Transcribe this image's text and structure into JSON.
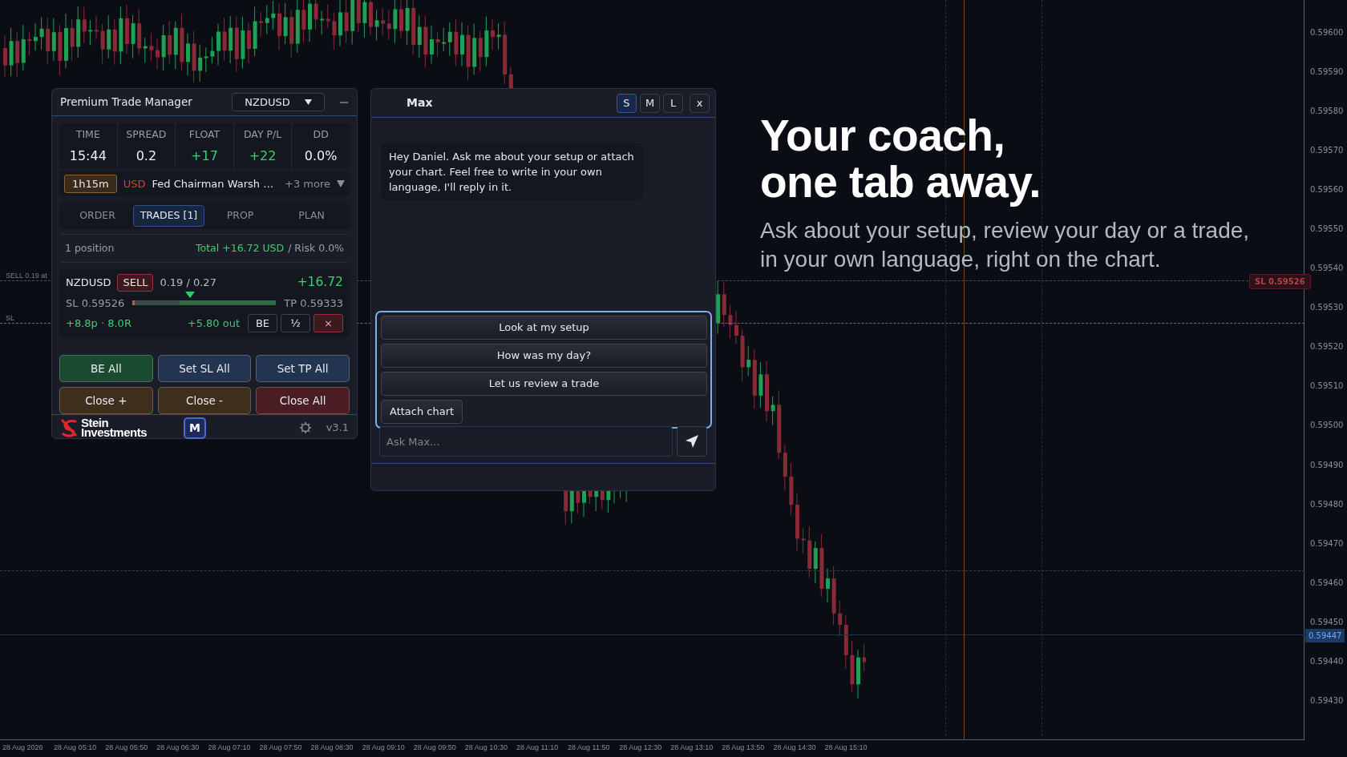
{
  "chart": {
    "price_labels": [
      "0.59600",
      "0.59590",
      "0.59580",
      "0.59570",
      "0.59560",
      "0.59550",
      "0.59540",
      "0.59530",
      "0.59520",
      "0.59510",
      "0.59500",
      "0.59490",
      "0.59480",
      "0.59470",
      "0.59460",
      "0.59450",
      "0.59440",
      "0.59430"
    ],
    "time_labels": [
      "28 Aug 2026",
      "28 Aug 05:10",
      "28 Aug 05:50",
      "28 Aug 06:30",
      "28 Aug 07:10",
      "28 Aug 07:50",
      "28 Aug 08:30",
      "28 Aug 09:10",
      "28 Aug 09:50",
      "28 Aug 10:30",
      "28 Aug 11:10",
      "28 Aug 11:50",
      "28 Aug 12:30",
      "28 Aug 13:10",
      "28 Aug 13:50",
      "28 Aug 14:30",
      "28 Aug 15:10"
    ],
    "current_price": "0.59447",
    "sl_tag": "SL 0.59526",
    "trade_line_label": "SELL 0.19 at",
    "sl_line_label": "SL"
  },
  "trade_manager": {
    "title": "Premium Trade Manager",
    "symbol": "NZDUSD",
    "stats": [
      {
        "label": "TIME",
        "value": "15:44",
        "kind": "plain"
      },
      {
        "label": "SPREAD",
        "value": "0.2",
        "kind": "plain"
      },
      {
        "label": "FLOAT",
        "value": "+17",
        "kind": "gain"
      },
      {
        "label": "DAY P/L",
        "value": "+22",
        "kind": "gain"
      },
      {
        "label": "DD",
        "value": "0.0%",
        "kind": "plain"
      }
    ],
    "news": {
      "countdown": "1h15m",
      "currency": "USD",
      "headline": "Fed Chairman Warsh …",
      "more": "+3 more"
    },
    "tabs": [
      {
        "label": "ORDER",
        "selected": false
      },
      {
        "label": "TRADES [1]",
        "selected": true
      },
      {
        "label": "PROP",
        "selected": false
      },
      {
        "label": "PLAN",
        "selected": false
      }
    ],
    "summary": {
      "count": "1 position",
      "total": "Total +16.72 USD",
      "risk": "/ Risk 0.0%"
    },
    "position": {
      "symbol": "NZDUSD",
      "side": "SELL",
      "lots": "0.19 / 0.27",
      "pnl": "+16.72",
      "sl": "SL 0.59526",
      "tp": "TP 0.59333",
      "level": 0.4,
      "pips": "+8.8p · 8.0R",
      "out": "+5.80 out",
      "buttons": [
        {
          "label": "BE",
          "kind": "plain"
        },
        {
          "label": "½",
          "kind": "plain"
        },
        {
          "label": "×",
          "kind": "danger"
        }
      ]
    },
    "actions": [
      {
        "label": "BE All",
        "color": "#1a4a30"
      },
      {
        "label": "Set SL All",
        "color": "#233450"
      },
      {
        "label": "Set TP All",
        "color": "#233450"
      },
      {
        "label": "Close +",
        "color": "#3e2e1c"
      },
      {
        "label": "Close -",
        "color": "#3e2e1c"
      },
      {
        "label": "Close All",
        "color": "#4a1c24"
      }
    ],
    "footer": {
      "logo_lines": [
        "Stein",
        "Investments"
      ],
      "coach_button": "M",
      "version": "v3.1"
    }
  },
  "chat": {
    "title": "Max",
    "sizes": [
      {
        "label": "S",
        "selected": true
      },
      {
        "label": "M",
        "selected": false
      },
      {
        "label": "L",
        "selected": false
      }
    ],
    "close": "x",
    "message": "Hey Daniel. Ask me about your setup or attach your chart. Feel free to write in your own language, I'll reply in it.",
    "suggestions": [
      {
        "label": "Look at my setup",
        "kind": "wide"
      },
      {
        "label": "How was my day?",
        "kind": "wide"
      },
      {
        "label": "Let us review a trade",
        "kind": "wide"
      },
      {
        "label": "Attach chart",
        "kind": "compact"
      }
    ],
    "input": {
      "placeholder": "Ask Max..."
    }
  },
  "promo": {
    "headline_lines": [
      "Your coach,",
      "one tab away."
    ],
    "subtitle_lines": [
      "Ask about your setup, review your day or a trade,",
      "in your own language, right on the chart."
    ]
  }
}
